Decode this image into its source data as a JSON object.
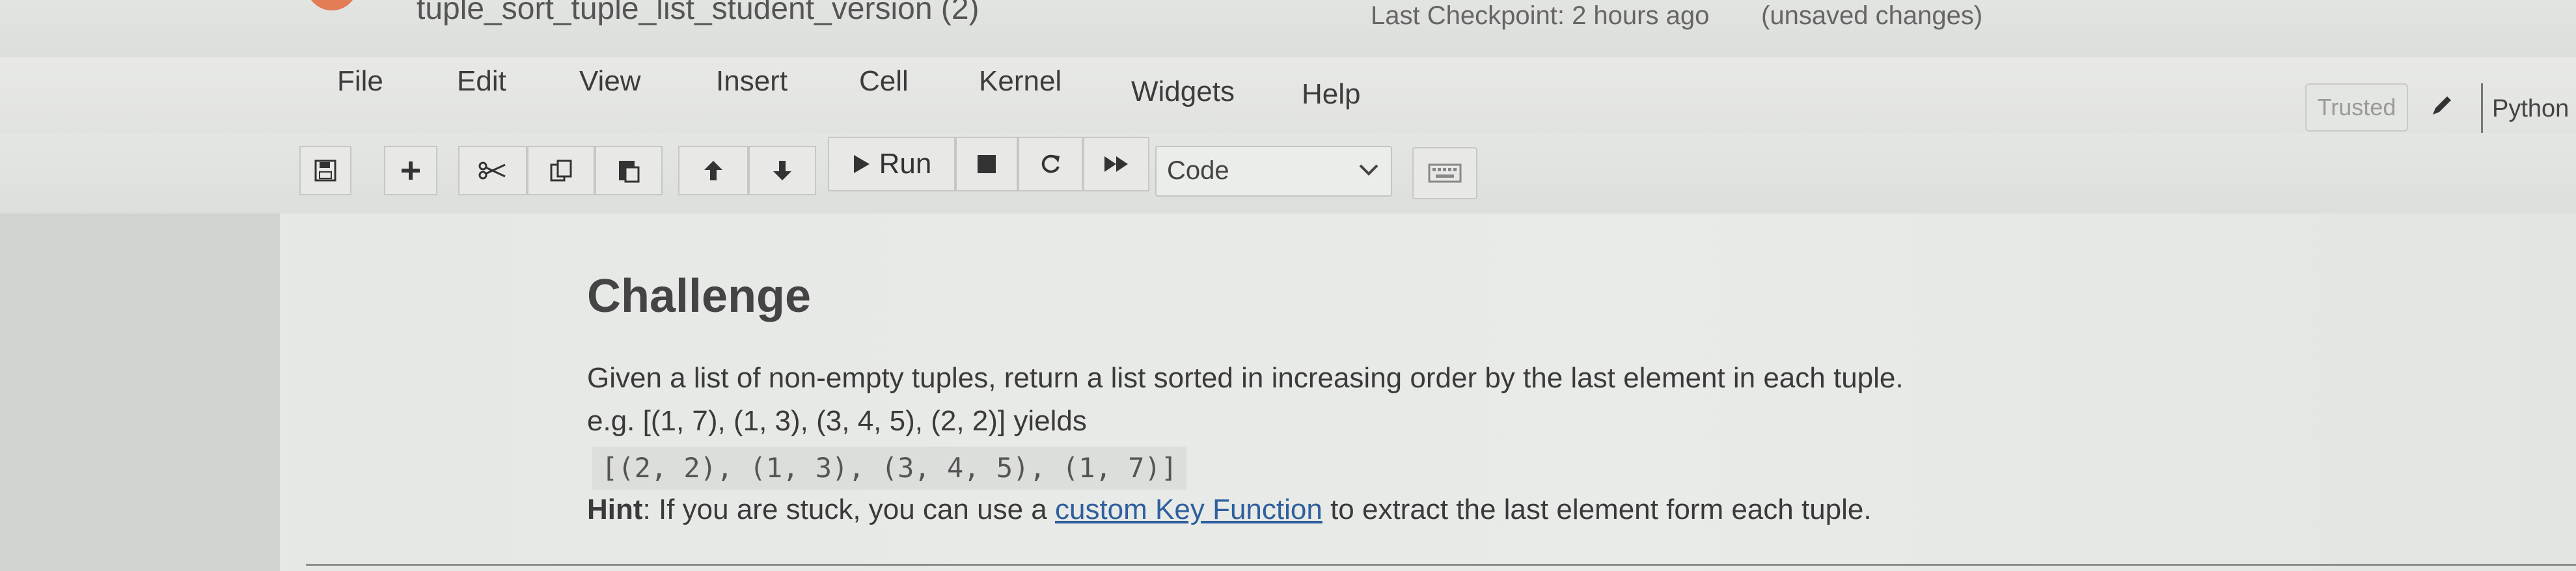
{
  "header": {
    "notebook_name": "tuple_sort_tuple_list_student_version (2)",
    "checkpoint": "Last Checkpoint: 2 hours ago",
    "unsaved": "(unsaved changes)"
  },
  "menubar": {
    "items": [
      "File",
      "Edit",
      "View",
      "Insert",
      "Cell",
      "Kernel",
      "Widgets",
      "Help"
    ],
    "trusted": "Trusted",
    "kernel": "Python"
  },
  "toolbar": {
    "run_label": "Run",
    "cell_type": "Code",
    "icons": [
      "save-icon",
      "plus-icon",
      "scissors-icon",
      "copy-icon",
      "paste-icon",
      "arrow-up-icon",
      "arrow-down-icon",
      "run-icon",
      "stop-icon",
      "restart-icon",
      "fast-forward-icon",
      "keyboard-icon"
    ]
  },
  "cell": {
    "heading": "Challenge",
    "description": "Given a list of non-empty tuples, return a list sorted in increasing order by the last element in each tuple.",
    "example": "e.g. [(1, 7), (1, 3), (3, 4, 5), (2, 2)] yields",
    "output": "[(2, 2), (1, 3), (3, 4, 5), (1, 7)]",
    "hint_label": "Hint",
    "hint_before": ": If you are stuck, you can use a ",
    "hint_link": "custom Key Function",
    "hint_after": " to extract the last element form each tuple."
  }
}
